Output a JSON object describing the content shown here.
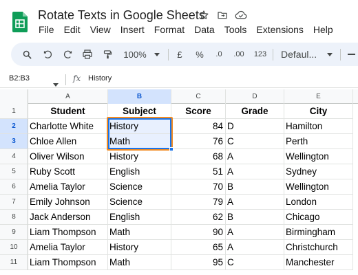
{
  "app": {
    "doc_title": "Rotate Texts in Google Sheets",
    "menu": [
      "File",
      "Edit",
      "View",
      "Insert",
      "Format",
      "Data",
      "Tools",
      "Extensions",
      "Help"
    ]
  },
  "toolbar": {
    "zoom": "100%",
    "currency": "£",
    "percent": "%",
    "decrease_decimal": ".0",
    "increase_decimal": ".00",
    "number_format": "123",
    "font": "Defaul..."
  },
  "formula_bar": {
    "name_box": "B2:B3",
    "fx": "fx",
    "value": "History"
  },
  "grid": {
    "columns": [
      "A",
      "B",
      "C",
      "D",
      "E"
    ],
    "selected_column": "B",
    "row_numbers": [
      "1",
      "2",
      "3",
      "4",
      "5",
      "6",
      "7",
      "8",
      "9",
      "10",
      "11"
    ],
    "selected_rows": [
      "2",
      "3"
    ],
    "headers": [
      "Student",
      "Subject",
      "Score",
      "Grade",
      "City"
    ],
    "rows": [
      [
        "Charlotte White",
        "History",
        "84",
        "D",
        "Hamilton"
      ],
      [
        "Chloe Allen",
        "Math",
        "76",
        "C",
        "Perth"
      ],
      [
        "Oliver Wilson",
        "History",
        "68",
        "A",
        "Wellington"
      ],
      [
        "Ruby Scott",
        "English",
        "51",
        "A",
        "Sydney"
      ],
      [
        "Amelia Taylor",
        "Science",
        "70",
        "B",
        "Wellington"
      ],
      [
        "Emily Johnson",
        "Science",
        "79",
        "A",
        "London"
      ],
      [
        "Jack Anderson",
        "English",
        "62",
        "B",
        "Chicago"
      ],
      [
        "Liam Thompson",
        "Math",
        "90",
        "A",
        "Birmingham"
      ],
      [
        "Amelia Taylor",
        "History",
        "65",
        "A",
        "Christchurch"
      ],
      [
        "Liam Thompson",
        "Math",
        "95",
        "C",
        "Manchester"
      ]
    ]
  },
  "colors": {
    "selection": "#1a73e8",
    "highlight_box": "#f28b22",
    "header_selected": "#d3e3fd",
    "toolbar_bg": "#edf2fa",
    "sheets_green": "#0f9d58"
  }
}
